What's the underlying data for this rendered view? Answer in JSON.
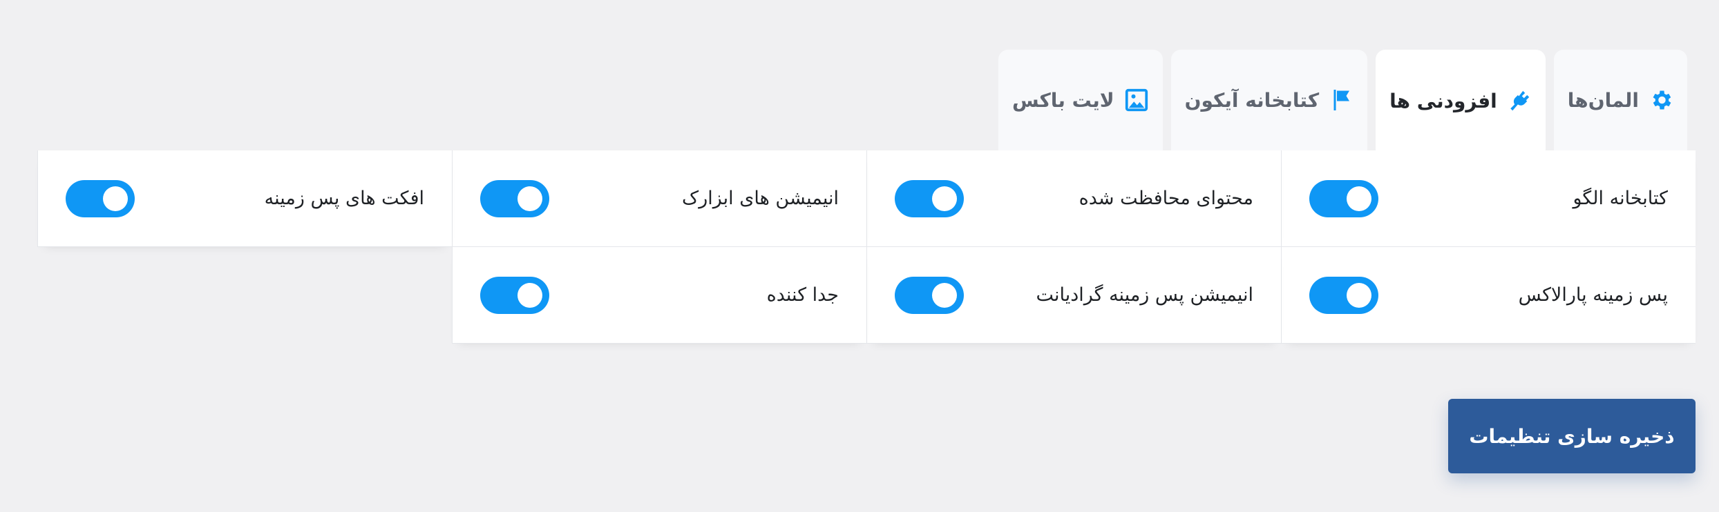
{
  "colors": {
    "accent": "#0f97f5",
    "save_button": "#2d5b9a",
    "background": "#f0f0f2"
  },
  "tabs": [
    {
      "label": "المان‌ها",
      "icon": "gear-icon",
      "active": false
    },
    {
      "label": "افزودنی ها",
      "icon": "plug-icon",
      "active": true
    },
    {
      "label": "کتابخانه آیکون",
      "icon": "flag-icon",
      "active": false
    },
    {
      "label": "لایت باکس",
      "icon": "image-icon",
      "active": false
    }
  ],
  "settings": [
    {
      "label": "کتابخانه الگو",
      "enabled": true
    },
    {
      "label": "محتوای محافظت شده",
      "enabled": true
    },
    {
      "label": "انیمیشن های ابزارک",
      "enabled": true
    },
    {
      "label": "افکت های پس زمینه",
      "enabled": true
    },
    {
      "label": "پس زمینه پارالاکس",
      "enabled": true
    },
    {
      "label": "انیمیشن پس زمینه گرادیانت",
      "enabled": true
    },
    {
      "label": "جدا کننده",
      "enabled": true
    }
  ],
  "save_button": {
    "label": "ذخیره سازی تنظیمات"
  }
}
